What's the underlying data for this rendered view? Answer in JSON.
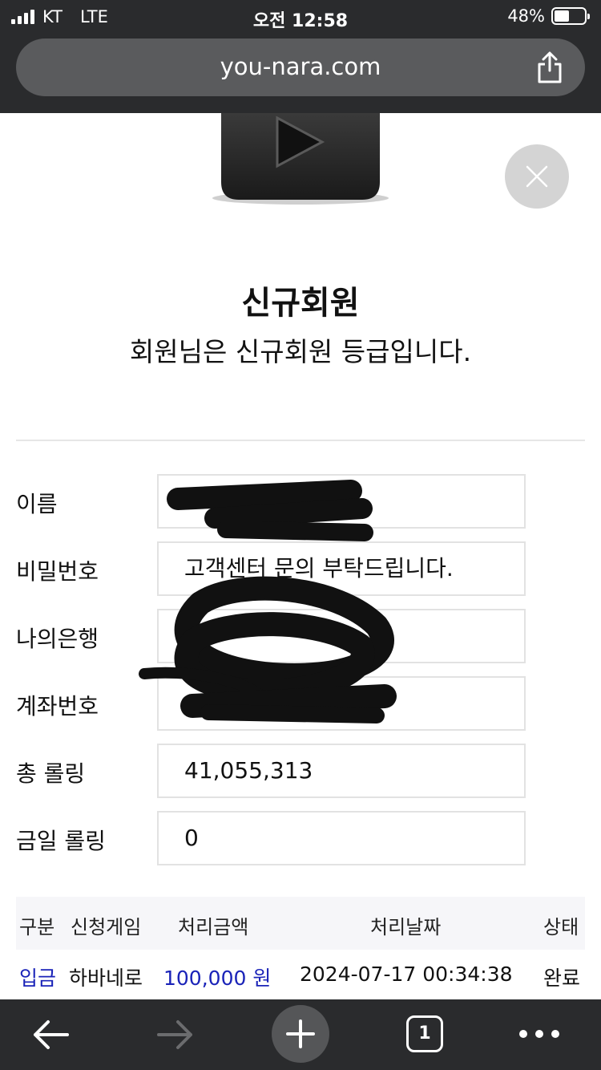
{
  "status_bar": {
    "carrier": "KT",
    "network": "LTE",
    "time": "오전 12:58",
    "battery": "48%",
    "battery_level": 0.48
  },
  "browser": {
    "url": "you-nara.com",
    "tab_count": "1"
  },
  "membership": {
    "title": "신규회원",
    "subtitle": "회원님은 신규회원 등급입니다."
  },
  "fields": [
    {
      "label": "이름",
      "value": ""
    },
    {
      "label": "비밀번호",
      "value": "고객센터 문의 부탁드립니다."
    },
    {
      "label": "나의은행",
      "value": ""
    },
    {
      "label": "계좌번호",
      "value": ""
    },
    {
      "label": "총 롤링",
      "value": "41,055,313"
    },
    {
      "label": "금일 롤링",
      "value": "0"
    }
  ],
  "history": {
    "headers": [
      "구분",
      "신청게임",
      "처리금액",
      "처리날짜",
      "상태"
    ],
    "rows": [
      {
        "type": "입금",
        "game": "하바네로",
        "amount": "100,000 원",
        "date": "2024-07-17 00:34:38",
        "status": "완료"
      }
    ]
  },
  "colors": {
    "chrome_bg": "#2a2b2d",
    "url_bar": "#5a5b5d",
    "accent_blue": "#1a23b8"
  }
}
